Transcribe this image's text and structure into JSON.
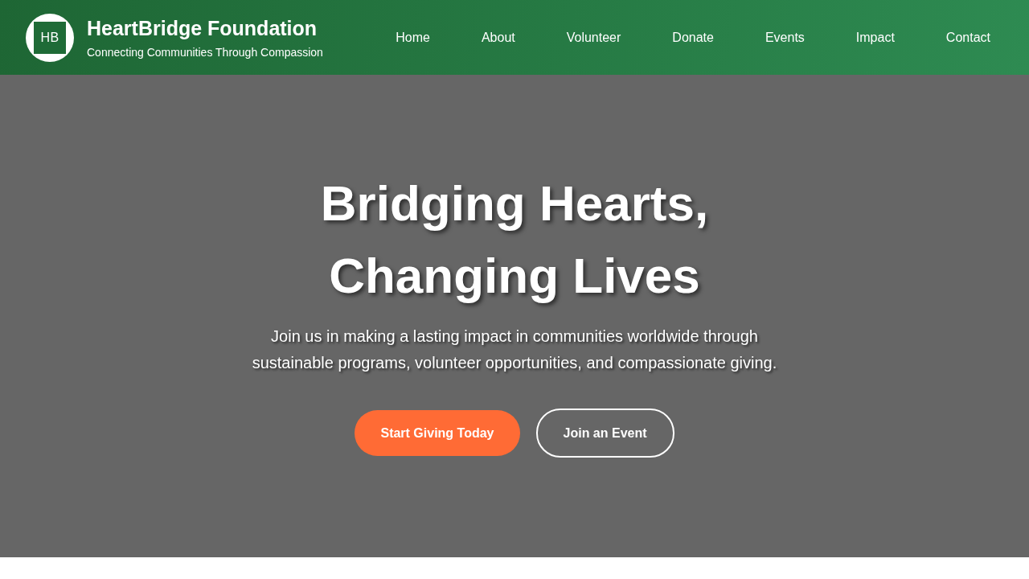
{
  "header": {
    "logo": {
      "initials": "HB"
    },
    "title": "HeartBridge Foundation",
    "tagline": "Connecting Communities Through Compassion",
    "nav": [
      {
        "label": "Home"
      },
      {
        "label": "About"
      },
      {
        "label": "Volunteer"
      },
      {
        "label": "Donate"
      },
      {
        "label": "Events"
      },
      {
        "label": "Impact"
      },
      {
        "label": "Contact"
      }
    ]
  },
  "hero": {
    "title": "Bridging Hearts, Changing Lives",
    "subtitle": "Join us in making a lasting impact in communities worldwide through sustainable programs, volunteer opportunities, and compassionate giving.",
    "buttons": [
      {
        "label": "Start Giving Today",
        "kind": "primary"
      },
      {
        "label": "Join an Event",
        "kind": "outline"
      }
    ]
  }
}
